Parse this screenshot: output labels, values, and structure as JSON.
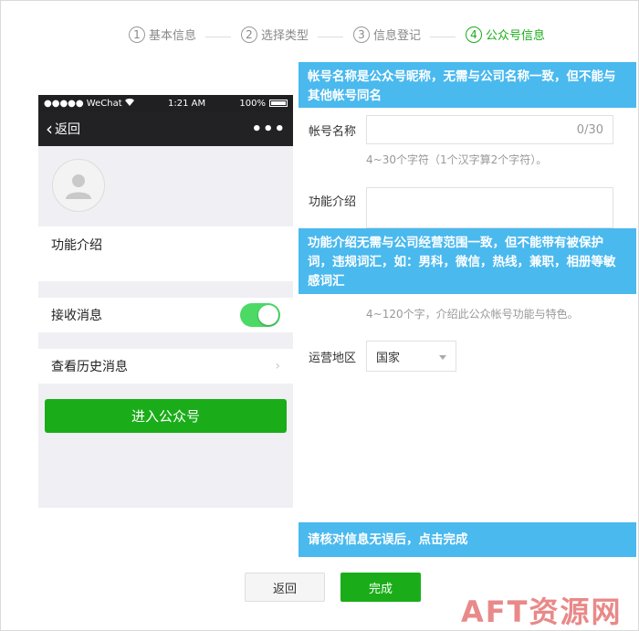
{
  "steps": [
    {
      "num": "1",
      "label": "基本信息"
    },
    {
      "num": "2",
      "label": "选择类型"
    },
    {
      "num": "3",
      "label": "信息登记"
    },
    {
      "num": "4",
      "label": "公众号信息"
    }
  ],
  "phone": {
    "status": {
      "carrier": "●●●●● WeChat",
      "time": "1:21 AM",
      "battery": "100%"
    },
    "nav": {
      "back": "返回",
      "more": "•••"
    },
    "intro_label": "功能介绍",
    "receive_label": "接收消息",
    "history_label": "查看历史消息",
    "enter_label": "进入公众号"
  },
  "tips": {
    "tip1": "帐号名称是公众号昵称，无需与公司名称一致，但不能与其他帐号同名",
    "tip2": "功能介绍无需与公司经营范围一致，但不能带有被保护词，违规词汇，如：男科，微信，热线，兼职，相册等敏感词汇",
    "tip3": "请核对信息无误后，点击完成"
  },
  "form": {
    "name_label": "帐号名称",
    "name_counter": "0/30",
    "name_hint": "4~30个字符（1个汉字算2个字符）。",
    "intro_label": "功能介绍",
    "intro_hint": "4~120个字，介绍此公众帐号功能与特色。",
    "region_label": "运营地区",
    "region_value": "国家"
  },
  "buttons": {
    "back": "返回",
    "done": "完成"
  },
  "watermark": "AFT资源网",
  "colors": {
    "accent": "#1aad19",
    "tip_bg": "#4ab9ee",
    "toggle": "#4cd964"
  }
}
